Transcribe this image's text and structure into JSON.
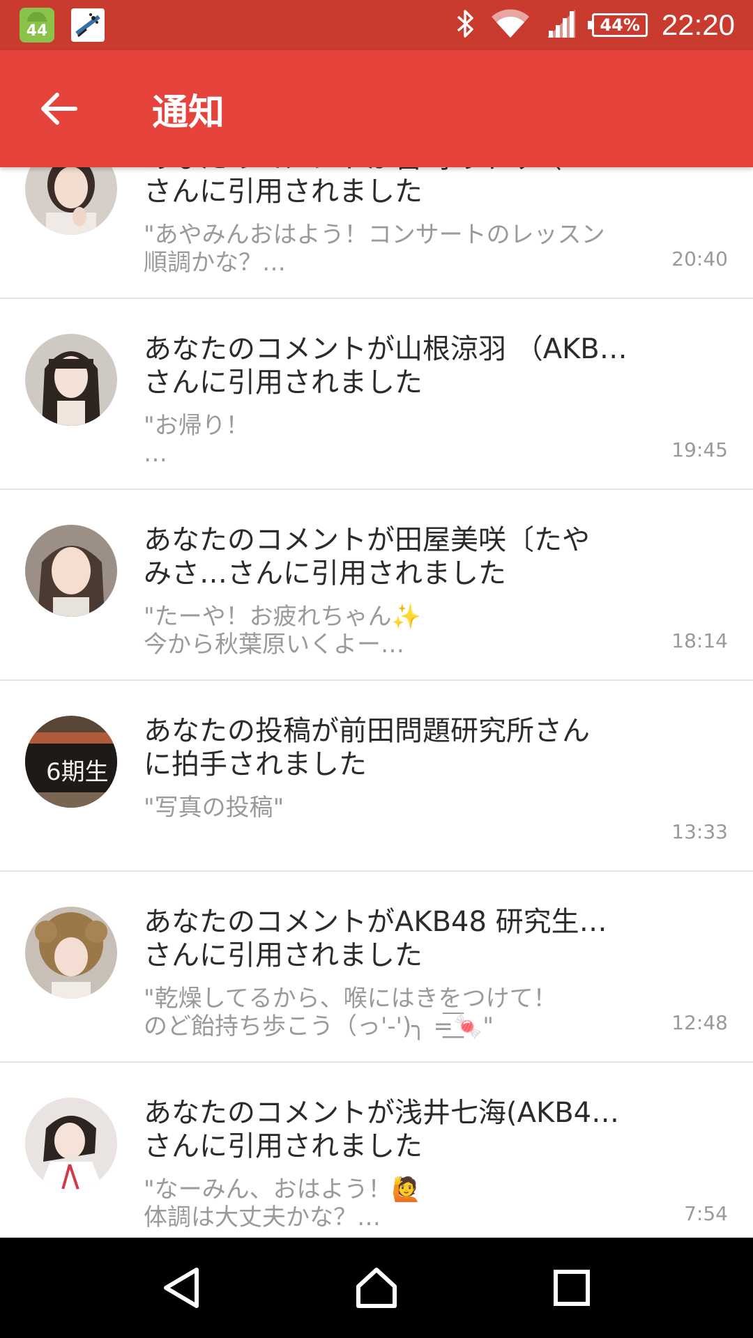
{
  "status_bar": {
    "android_badge": "44",
    "battery": "44%",
    "time": "22:20",
    "color": "#c93a2f"
  },
  "app_bar": {
    "title": "通知",
    "back_icon": "arrow-back-icon",
    "color": "#e5433b"
  },
  "notifications": [
    {
      "title_line1": "あなたのコメントが宮崎あやみ（AKB…",
      "title_line2": "さんに引用されました",
      "body_line1": "\"あやみんおはよう！コンサートのレッスン",
      "body_line2": "順調かな？…",
      "time": "20:40"
    },
    {
      "title_line1": "あなたのコメントが山根涼羽 （AKB…",
      "title_line2": "さんに引用されました",
      "body_line1": "\"お帰り！",
      "body_line2": "…",
      "time": "19:45"
    },
    {
      "title_line1": "あなたのコメントが田屋美咲〔たや",
      "title_line2": "みさ…さんに引用されました",
      "body_line1": "\"たーや！お疲れちゃん✨",
      "body_line2": "今から秋葉原いくよー…",
      "time": "18:14"
    },
    {
      "title_line1": "あなたの投稿が前田問題研究所さん",
      "title_line2": "に拍手されました",
      "body_line1": "\"写真の投稿\"",
      "body_line2": "",
      "time": "13:33"
    },
    {
      "title_line1": "あなたのコメントがAKB48 研究生…",
      "title_line2": "さんに引用されました",
      "body_line1": "\"乾燥してるから、喉にはきをつけて！",
      "body_line2": "のど飴持ち歩こう（っ'-')╮ =͟͟͞🍬\"",
      "time": "12:48"
    },
    {
      "title_line1": "あなたのコメントが浅井七海(AKB4…",
      "title_line2": "さんに引用されました",
      "body_line1": "\"なーみん、おはよう！🙋",
      "body_line2": "体調は大丈夫かな？…",
      "time": "7:54"
    }
  ],
  "nav_bar": {
    "back": "nav-back-icon",
    "home": "nav-home-icon",
    "recents": "nav-recents-icon"
  }
}
